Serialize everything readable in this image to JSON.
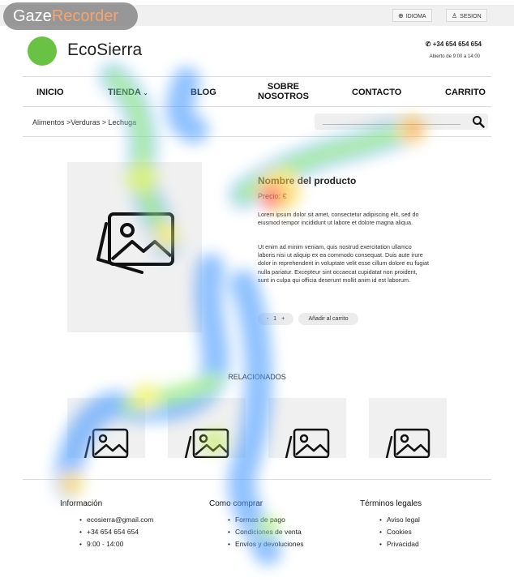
{
  "overlay": {
    "brand_part1": "Gaze",
    "brand_part2": "Recorder"
  },
  "topbar": {
    "language": {
      "label": "IDIOMA",
      "icon": "globe-icon"
    },
    "session": {
      "label": "SESION",
      "icon": "user-icon"
    }
  },
  "header": {
    "brand": "EcoSierra",
    "phone": "+34 654 654 654",
    "phone_icon": "phone-icon",
    "hours": "Abierto de 9:00 a 14:00"
  },
  "nav": {
    "inicio": "INICIO",
    "tienda": "TIENDA",
    "blog": "BLOG",
    "sobre_line1": "SOBRE",
    "sobre_line2": "NOSOTROS",
    "contacto": "CONTACTO",
    "carrito": "CARRITO"
  },
  "breadcrumb": "Alimentos >Verduras > Lechuga",
  "search": {
    "placeholder": "",
    "icon": "search-icon"
  },
  "product": {
    "title": "Nombre del producto",
    "price": "Precio: €",
    "description_1": "Lorem ipsum dolor sit amet, consectetur adipiscing elit, sed do eiusmod tempor incididunt ut labore et dolore magna aliqua.",
    "description_2": "Ut enim ad minim veniam, quis nostrud exercitation ullamco laboris nisi ut aliquip ex ea commodo consequat. Duis aute irure dolor in reprehenderit in voluptate velit esse cillum dolore eu fugiat nulla pariatur. Excepteur sint occaecat cupidatat non proident, sunt in culpa qui officia deserunt mollit anim id est laborum.",
    "qty_minus": "-",
    "qty_value": "1",
    "qty_plus": "+",
    "add_to_cart": "Añadir al carrito"
  },
  "related": {
    "title": "RELACIONADOS"
  },
  "footer": {
    "info": {
      "title": "Información",
      "items": [
        "ecosierra@gmail.com",
        "+34 654 654 654",
        "9:00 - 14:00"
      ]
    },
    "buy": {
      "title": "Como comprar",
      "items": [
        "Formas de pago",
        "Condiciones de venta",
        "Envíos y devoluciones"
      ]
    },
    "legal": {
      "title": "Términos legales",
      "items": [
        "Aviso legal",
        "Cookies",
        "Privacidad"
      ]
    }
  },
  "colors": {
    "logo": "#6ac244",
    "placeholder_bg": "#f0f0f0",
    "topbar_bg": "#f0f0f0"
  }
}
